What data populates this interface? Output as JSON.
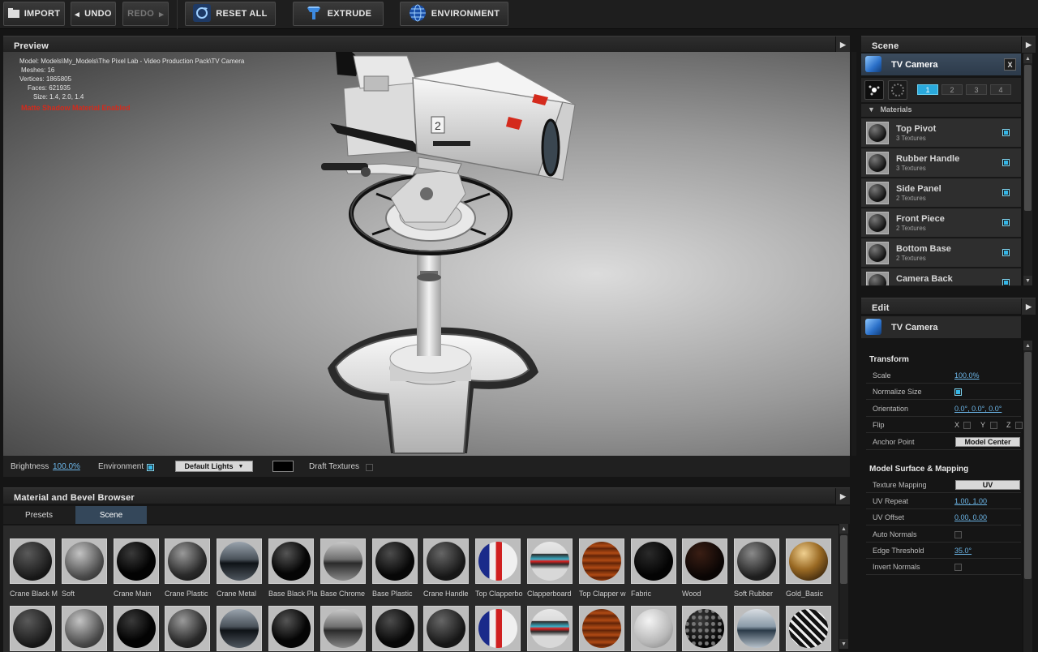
{
  "toolbar": {
    "import": "IMPORT",
    "undo": "UNDO",
    "redo": "REDO",
    "reset_all": "RESET ALL",
    "extrude": "EXTRUDE",
    "environment": "ENVIRONMENT"
  },
  "preview": {
    "title": "Preview",
    "info": [
      "Model: Models\\My_Models\\The Pixel Lab - Video Production Pack\\TV Camera",
      "Meshes: 16",
      "Vertices: 1865805",
      "Faces: 621935",
      "Size: 1.4, 2.0, 1.4"
    ],
    "matte": "Matte Shadow Material Enabled",
    "camera_number": "2",
    "bar": {
      "brightness_label": "Brightness",
      "brightness_value": "100.0%",
      "environment_label": "Environment",
      "lights_value": "Default Lights",
      "draft_label": "Draft Textures"
    }
  },
  "browser": {
    "title": "Material and Bevel Browser",
    "tabs": [
      "Presets",
      "Scene"
    ],
    "active_tab": "Scene",
    "row1": [
      {
        "label": "Crane Black M",
        "ball": "radial-gradient(circle at 38% 30%,#5a5a5a,#161616 70%)"
      },
      {
        "label": "Soft",
        "ball": "radial-gradient(circle at 38% 30%,#c4c4c4,#4a4a4a 65%,#222 100%)"
      },
      {
        "label": "Crane Main",
        "ball": "radial-gradient(circle at 38% 30%,#3a3a3a,#030303 55%)"
      },
      {
        "label": "Crane Plastic",
        "ball": "radial-gradient(circle at 38% 30%,#9a9a9a,#2a2a2a 60%,#0e0e0e 100%)"
      },
      {
        "label": "Crane Metal",
        "ball": "linear-gradient(#9aa4ae 0%,#4a525a 45%,#0e1216 55%,#505860 100%)"
      },
      {
        "label": "Base Black Pla",
        "ball": "radial-gradient(circle at 38% 30%,#555,#050505 55%)"
      },
      {
        "label": "Base Chrome",
        "ball": "linear-gradient(#c8c8c8 0%,#707070 45%,#2a2a2a 55%,#8a8a8a 100%)"
      },
      {
        "label": "Base Plastic",
        "ball": "radial-gradient(circle at 38% 30%,#4c4c4c,#070707 60%)"
      },
      {
        "label": "Crane Handle",
        "ball": "radial-gradient(circle at 38% 30%,#666,#161616 65%)"
      },
      {
        "label": "Top Clapperbo",
        "ball": "linear-gradient(90deg,#1a2a8a 0%,#1a2a8a 28%,#f0f0f0 28%,#f0f0f0 45%,#d02020 45%,#d02020 60%,#f0f0f0 60%)"
      },
      {
        "label": "Clapperboard",
        "ball": "linear-gradient(#e8e8e8 0%,#dcdcdc 30%,#2a2a2a 32%,#3ab0c8 45%,#e02020 50%,#2a2a2a 58%,#d8d8d8 70%)"
      },
      {
        "label": "Top Clapper w",
        "ball": "repeating-linear-gradient(#6a2a0a 0px,#b04a14 5px,#5a1e06 9px)"
      },
      {
        "label": "Fabric",
        "ball": "radial-gradient(circle at 38% 30%,#2a2a2a,#040404 60%)"
      },
      {
        "label": "Wood",
        "ball": "radial-gradient(circle at 38% 30%,#3a1e14,#0a0504 65%)"
      },
      {
        "label": "Soft Rubber",
        "ball": "radial-gradient(circle at 38% 30%,#8a8a8a,#1e1e1e 65%)"
      },
      {
        "label": "Gold_Basic",
        "ball": "radial-gradient(circle at 38% 30%,#f0d090,#9a6a24 45%,#2a1a08 90%)"
      }
    ],
    "row2": [
      {
        "ball": "radial-gradient(circle at 38% 30%,#5a5a5a,#161616 70%)"
      },
      {
        "ball": "radial-gradient(circle at 38% 30%,#c4c4c4,#4a4a4a 65%,#222 100%)"
      },
      {
        "ball": "radial-gradient(circle at 38% 30%,#3a3a3a,#030303 55%)"
      },
      {
        "ball": "radial-gradient(circle at 38% 30%,#9a9a9a,#2a2a2a 60%,#0e0e0e 100%)"
      },
      {
        "ball": "linear-gradient(#9aa4ae 0%,#4a525a 45%,#0e1216 55%,#505860 100%)"
      },
      {
        "ball": "radial-gradient(circle at 38% 30%,#555,#050505 55%)"
      },
      {
        "ball": "linear-gradient(#c8c8c8 0%,#707070 45%,#2a2a2a 55%,#8a8a8a 100%)"
      },
      {
        "ball": "radial-gradient(circle at 38% 30%,#4c4c4c,#070707 60%)"
      },
      {
        "ball": "radial-gradient(circle at 38% 30%,#666,#161616 65%)"
      },
      {
        "ball": "linear-gradient(90deg,#1a2a8a 0%,#1a2a8a 28%,#f0f0f0 28%,#f0f0f0 45%,#d02020 45%,#d02020 60%,#f0f0f0 60%)"
      },
      {
        "ball": "linear-gradient(#e8e8e8 0%,#dcdcdc 30%,#2a2a2a 32%,#3ab0c8 45%,#e02020 50%,#2a2a2a 58%,#d8d8d8 70%)"
      },
      {
        "ball": "repeating-linear-gradient(#6a2a0a 0px,#b04a14 5px,#5a1e06 9px)"
      },
      {
        "ball": "radial-gradient(circle at 38% 30%,#f4f4f4,#b8b8b8 60%,#7a7a7a 100%)"
      },
      {
        "ball": "radial-gradient(circle at 30% 30%,#777 0 2px,transparent 3px) 0 0/8px 8px,radial-gradient(circle at 38% 30%,#3a3a3a,#050505 70%)"
      },
      {
        "ball": "linear-gradient(#d8dde2 0%,#8a9aa8 45%,#2a3a48 55%,#b8c2cc 100%)"
      },
      {
        "ball": "repeating-linear-gradient(45deg,#eee 0 3px,#111 3px 8px)"
      }
    ]
  },
  "scene": {
    "title": "Scene",
    "object": "TV Camera",
    "close": "X",
    "tabs": [
      "1",
      "2",
      "3",
      "4"
    ],
    "materials_header": "Materials",
    "materials": [
      {
        "name": "Top Pivot",
        "sub": "3 Textures"
      },
      {
        "name": "Rubber Handle",
        "sub": "3 Textures"
      },
      {
        "name": "Side Panel",
        "sub": "2 Textures"
      },
      {
        "name": "Front Piece",
        "sub": "2 Textures"
      },
      {
        "name": "Bottom Base",
        "sub": "2 Textures"
      },
      {
        "name": "Camera Back",
        "sub": ""
      }
    ]
  },
  "edit": {
    "title": "Edit",
    "object": "TV Camera",
    "transform": "Transform",
    "scale_label": "Scale",
    "scale_value": "100.0%",
    "normalize_label": "Normalize Size",
    "orientation_label": "Orientation",
    "orientation_value": "0.0°, 0.0°, 0.0°",
    "flip_label": "Flip",
    "flip_x": "X",
    "flip_y": "Y",
    "flip_z": "Z",
    "anchor_label": "Anchor Point",
    "anchor_value": "Model Center",
    "surface": "Model Surface & Mapping",
    "mapping_label": "Texture Mapping",
    "mapping_value": "UV",
    "uv_repeat_label": "UV Repeat",
    "uv_repeat_value": "1.00, 1.00",
    "uv_offset_label": "UV Offset",
    "uv_offset_value": "0.00, 0.00",
    "auto_normals_label": "Auto Normals",
    "edge_label": "Edge Threshold",
    "edge_value": "35.0°",
    "invert_label": "Invert Normals"
  }
}
